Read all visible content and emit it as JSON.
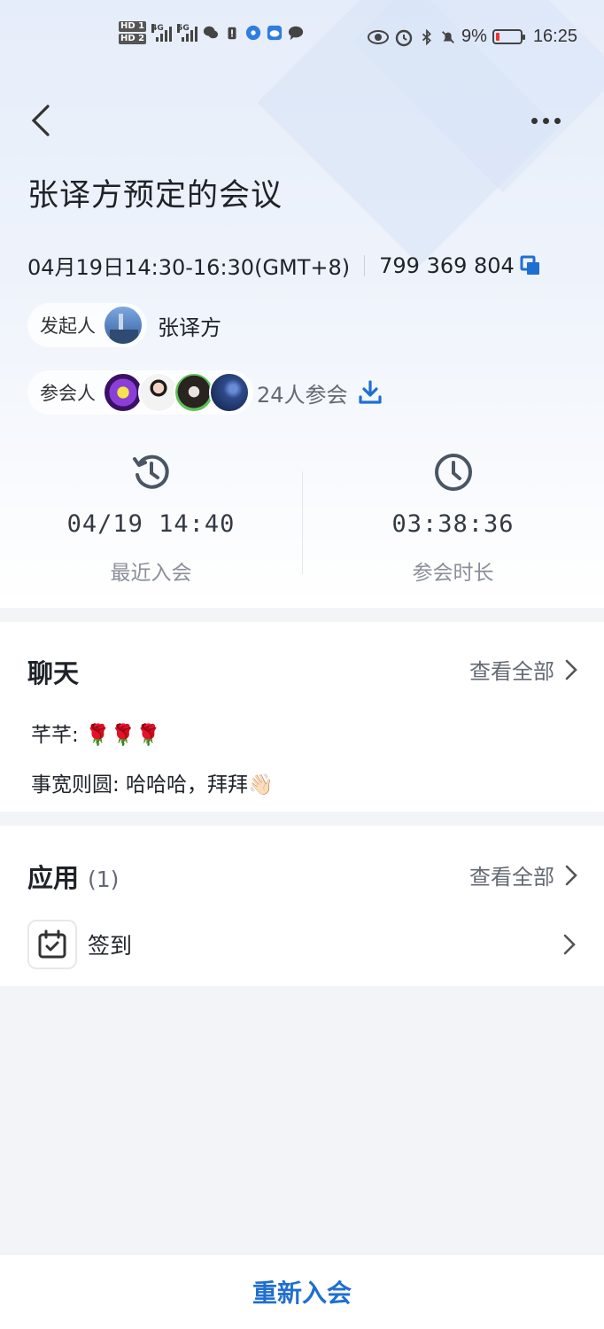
{
  "status_bar": {
    "hd1": "HD 1",
    "hd2": "HD 2",
    "net1": "4G",
    "net2": "5G",
    "battery": "9%",
    "time": "16:25"
  },
  "header": {
    "title": "张译方预定的会议"
  },
  "meeting": {
    "datetime": "04月19日14:30-16:30(GMT+8)",
    "meeting_id": "799 369 804",
    "organizer_label": "发起人",
    "organizer_name": "张译方",
    "participants_label": "参会人",
    "participants_count": "24人参会"
  },
  "stats": {
    "recent_join_value": "04/19 14:40",
    "recent_join_label": "最近入会",
    "duration_value": "03:38:36",
    "duration_label": "参会时长"
  },
  "chat": {
    "title": "聊天",
    "view_all": "查看全部",
    "messages": [
      {
        "text": "芊芊: 🌹🌹🌹"
      },
      {
        "text": "事宽则圆: 哈哈哈，拜拜👋🏻"
      }
    ]
  },
  "apps": {
    "title": "应用",
    "count": "(1)",
    "view_all": "查看全部",
    "items": [
      {
        "label": "签到",
        "icon": "calendar-check-icon"
      }
    ]
  },
  "bottom": {
    "rejoin_label": "重新入会"
  },
  "colors": {
    "accent": "#1f6fd1",
    "battery_low": "#e33333"
  }
}
